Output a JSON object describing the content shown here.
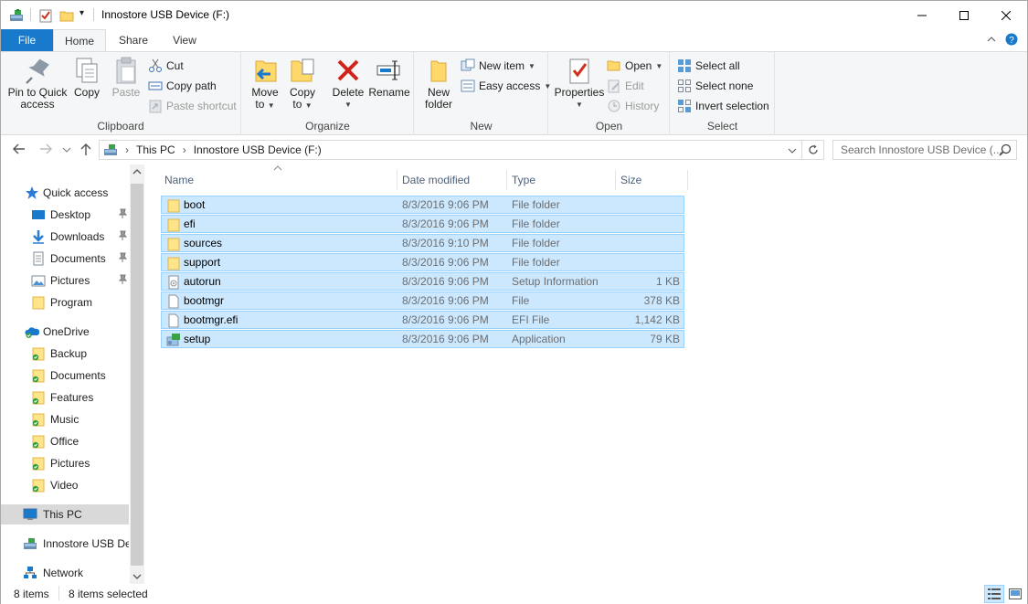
{
  "window": {
    "title": "Innostore USB Device (F:)",
    "qat_dropdown": "▾",
    "minimize_label": "—",
    "maximize_label": "☐",
    "close_label": "✕"
  },
  "tabs": [
    {
      "label": "File"
    },
    {
      "label": "Home"
    },
    {
      "label": "Share"
    },
    {
      "label": "View"
    }
  ],
  "ribbon": {
    "clipboard": {
      "pin_line1": "Pin to Quick",
      "pin_line2": "access",
      "copy": "Copy",
      "paste": "Paste",
      "cut": "Cut",
      "copy_path": "Copy path",
      "paste_shortcut": "Paste shortcut",
      "group": "Clipboard"
    },
    "organize": {
      "move_line1": "Move",
      "move_line2": "to",
      "copy_line1": "Copy",
      "copy_line2": "to",
      "delete": "Delete",
      "rename": "Rename",
      "group": "Organize"
    },
    "new": {
      "folder_line1": "New",
      "folder_line2": "folder",
      "new_item": "New item",
      "easy_access": "Easy access",
      "group": "New"
    },
    "open": {
      "properties": "Properties",
      "open": "Open",
      "edit": "Edit",
      "history": "History",
      "group": "Open"
    },
    "select": {
      "select_all": "Select all",
      "select_none": "Select none",
      "invert": "Invert selection",
      "group": "Select"
    }
  },
  "address": {
    "crumbs": [
      "This PC",
      "Innostore USB Device (F:)"
    ],
    "separator": "›",
    "search_placeholder": "Search Innostore USB Device (..."
  },
  "nav": {
    "quick_access": "Quick access",
    "quick_items": [
      "Desktop",
      "Downloads",
      "Documents",
      "Pictures",
      "Program"
    ],
    "onedrive": "OneDrive",
    "onedrive_items": [
      "Backup",
      "Documents",
      "Features",
      "Music",
      "Office",
      "Pictures",
      "Video"
    ],
    "this_pc": "This PC",
    "usb": "Innostore USB Device (F:)",
    "network": "Network"
  },
  "columns": {
    "name": "Name",
    "date": "Date modified",
    "type": "Type",
    "size": "Size"
  },
  "files": [
    {
      "name": "boot",
      "date": "8/3/2016 9:06 PM",
      "type": "File folder",
      "size": "",
      "icon": "folder-icon"
    },
    {
      "name": "efi",
      "date": "8/3/2016 9:06 PM",
      "type": "File folder",
      "size": "",
      "icon": "folder-icon"
    },
    {
      "name": "sources",
      "date": "8/3/2016 9:10 PM",
      "type": "File folder",
      "size": "",
      "icon": "folder-icon"
    },
    {
      "name": "support",
      "date": "8/3/2016 9:06 PM",
      "type": "File folder",
      "size": "",
      "icon": "folder-icon"
    },
    {
      "name": "autorun",
      "date": "8/3/2016 9:06 PM",
      "type": "Setup Information",
      "size": "1 KB",
      "icon": "setup-info-icon"
    },
    {
      "name": "bootmgr",
      "date": "8/3/2016 9:06 PM",
      "type": "File",
      "size": "378 KB",
      "icon": "file-icon"
    },
    {
      "name": "bootmgr.efi",
      "date": "8/3/2016 9:06 PM",
      "type": "EFI File",
      "size": "1,142 KB",
      "icon": "file-icon"
    },
    {
      "name": "setup",
      "date": "8/3/2016 9:06 PM",
      "type": "Application",
      "size": "79 KB",
      "icon": "setup-app-icon"
    }
  ],
  "status": {
    "count": "8 items",
    "selected": "8 items selected"
  },
  "colors": {
    "accent": "#1979ca",
    "selection": "#cce8ff",
    "selection_border": "#99d1ff"
  }
}
